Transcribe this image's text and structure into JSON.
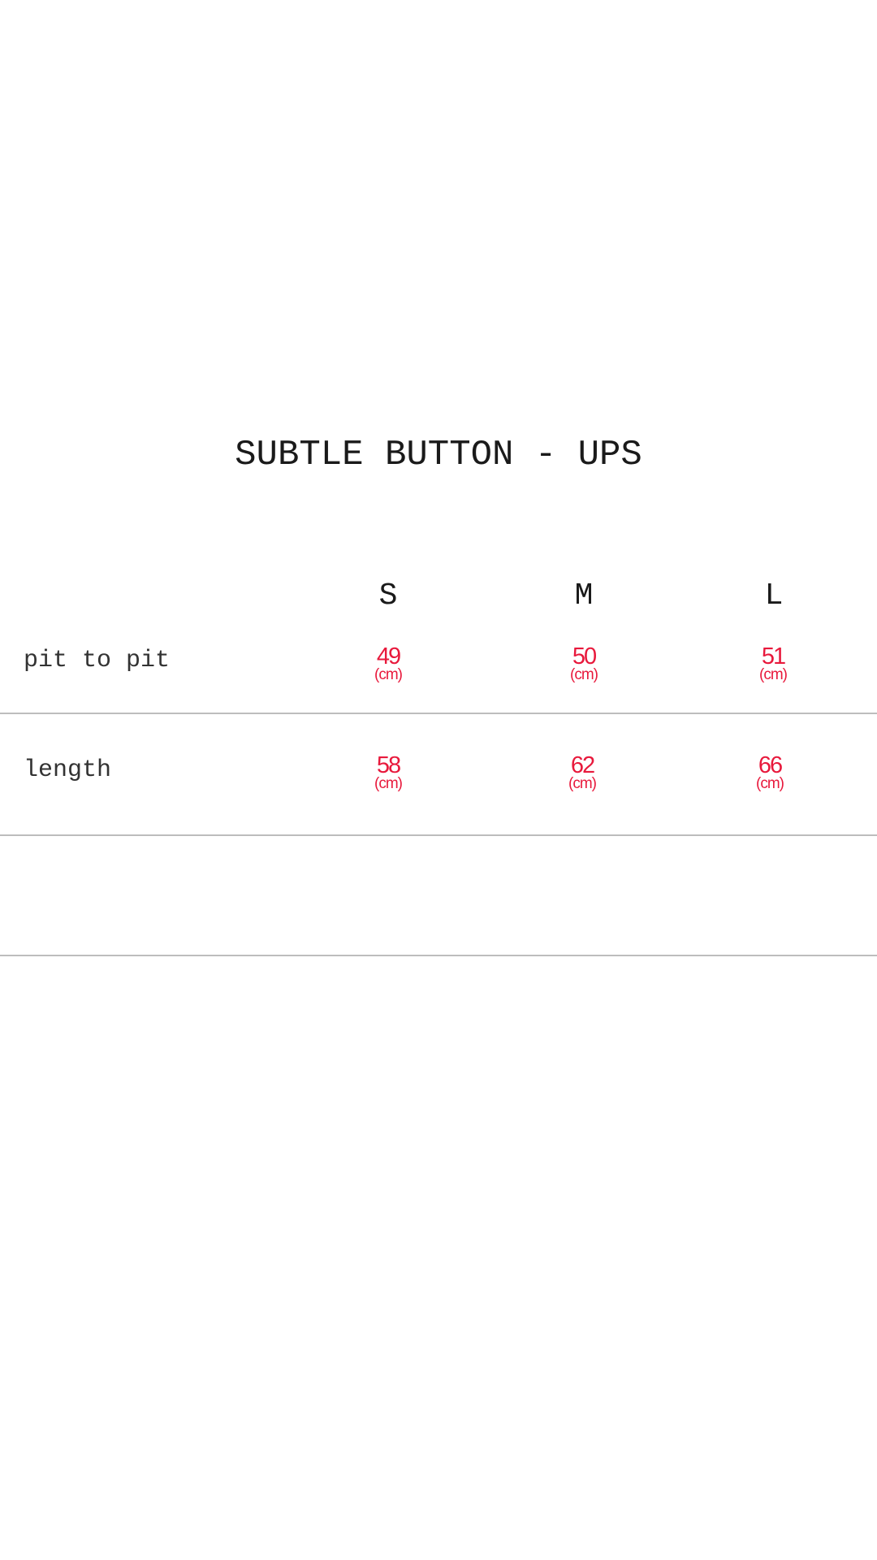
{
  "title": "SUBTLE BUTTON - UPS",
  "sizes": [
    "S",
    "M",
    "L"
  ],
  "rows": [
    {
      "label": "pit to pit",
      "values": [
        {
          "value": "49",
          "unit": "(cm)"
        },
        {
          "value": "50",
          "unit": "(cm)"
        },
        {
          "value": "51",
          "unit": "(cm)"
        }
      ]
    },
    {
      "label": "length",
      "values": [
        {
          "value": "58",
          "unit": "(cm)"
        },
        {
          "value": "62",
          "unit": "(cm)"
        },
        {
          "value": "66",
          "unit": "(cm)"
        }
      ]
    }
  ],
  "colors": {
    "value_text": "#e8193c",
    "label_text": "#333333",
    "divider": "#bdbdbd",
    "background": "#ffffff"
  }
}
